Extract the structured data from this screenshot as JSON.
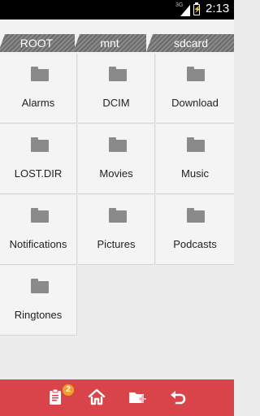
{
  "status_bar": {
    "network": "3G",
    "time": "2:13"
  },
  "breadcrumbs": [
    "ROOT",
    "mnt",
    "sdcard"
  ],
  "folders": [
    "Alarms",
    "DCIM",
    "Download",
    "LOST.DIR",
    "Movies",
    "Music",
    "Notifications",
    "Pictures",
    "Podcasts",
    "Ringtones"
  ],
  "bottom_bar": {
    "clipboard_badge": "2",
    "icons": [
      "clipboard-icon",
      "home-icon",
      "new-folder-icon",
      "undo-icon"
    ]
  },
  "colors": {
    "accent": "#d9434a",
    "badge": "#f1a12a",
    "folder": "#8a8a8a"
  }
}
